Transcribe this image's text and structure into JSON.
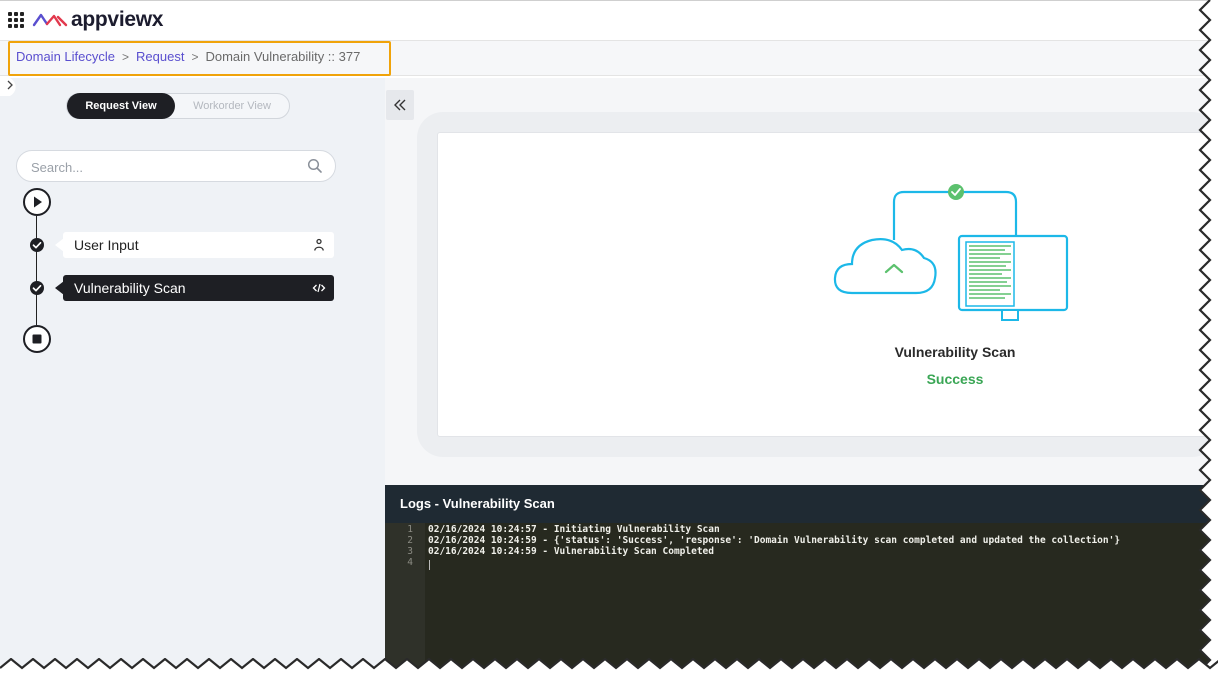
{
  "header": {
    "brand": "appviewx",
    "apps_icon": "grid-apps-icon",
    "logo_icon": "appviewx-logo-icon"
  },
  "breadcrumb": {
    "items": [
      "Domain Lifecycle",
      "Request"
    ],
    "separator": ">",
    "current": "Domain Vulnerability :: 377"
  },
  "sidebar": {
    "view_toggle": {
      "active": "Request View",
      "inactive": "Workorder View"
    },
    "search": {
      "placeholder": "Search...",
      "value": ""
    },
    "steps": [
      {
        "label": "User Input",
        "icon": "user-icon",
        "status": "completed"
      },
      {
        "label": "Vulnerability Scan",
        "icon": "code-icon",
        "status": "completed",
        "selected": true
      }
    ]
  },
  "main": {
    "collapse_icon": "double-chevron-left-icon",
    "card": {
      "title": "Vulnerability Scan",
      "status": "Success",
      "status_color": "#3aa655"
    }
  },
  "logs": {
    "title": "Logs - Vulnerability Scan",
    "lines": [
      {
        "n": "1",
        "text": "02/16/2024 10:24:57  - Initiating Vulnerability Scan"
      },
      {
        "n": "2",
        "text": "02/16/2024 10:24:59  - {'status': 'Success', 'response': 'Domain Vulnerability scan completed and updated the collection'}"
      },
      {
        "n": "3",
        "text": "02/16/2024 10:24:59  - Vulnerability Scan Completed"
      },
      {
        "n": "4",
        "text": ""
      }
    ]
  },
  "colors": {
    "accent": "#5a4fcf",
    "highlight": "#f0a30a",
    "dark": "#1e1f24",
    "illustration": "#1cb8e8",
    "success": "#3aa655"
  }
}
